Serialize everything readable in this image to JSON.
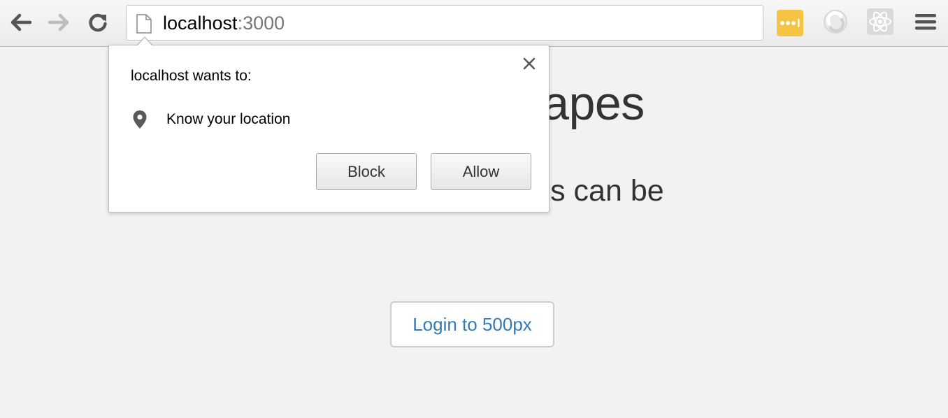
{
  "browser": {
    "url_host": "localhost",
    "url_port": ":3000",
    "nav": {
      "back_icon": "arrow-left-icon",
      "forward_icon": "arrow-right-icon",
      "reload_icon": "reload-icon"
    },
    "extensions": [
      {
        "name": "lastpass-icon",
        "color": "#f5c443"
      },
      {
        "name": "sync-extension-icon"
      },
      {
        "name": "react-devtools-icon"
      }
    ],
    "menu_icon": "hamburger-menu-icon"
  },
  "page": {
    "heading_visible": "capes",
    "lede_visible": "urroundings can be",
    "login_button": "Login to 500px",
    "link_color": "#337ab7"
  },
  "permission_bubble": {
    "title": "localhost wants to:",
    "permission": "Know your location",
    "permission_icon": "location-pin-icon",
    "close_icon": "close-icon",
    "block_label": "Block",
    "allow_label": "Allow"
  }
}
